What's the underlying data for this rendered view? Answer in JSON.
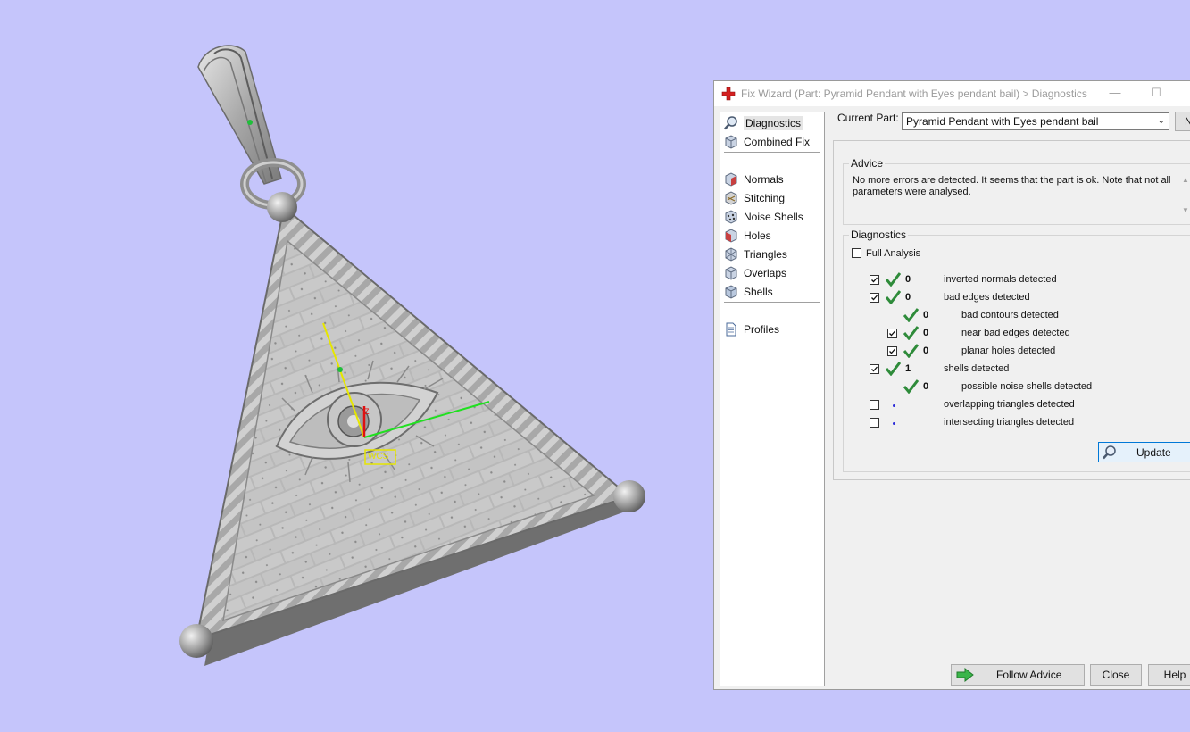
{
  "window": {
    "title": "Fix Wizard (Part: Pyramid Pendant with Eyes pendant bail) > Diagnostics",
    "minimize_symbol": "—",
    "maximize_symbol": "☐"
  },
  "viewport": {
    "axis_label_z": "Z",
    "wcs_label": "WCS",
    "background_color": "#c5c5fb"
  },
  "nav": {
    "items": [
      {
        "label": "Diagnostics",
        "icon": "magnifier-icon",
        "selected": true
      },
      {
        "label": "Combined Fix",
        "icon": "cube-icon"
      },
      {
        "label": "Normals",
        "icon": "normals-cube-icon"
      },
      {
        "label": "Stitching",
        "icon": "stitching-cube-icon"
      },
      {
        "label": "Noise Shells",
        "icon": "noise-shells-icon"
      },
      {
        "label": "Holes",
        "icon": "holes-cube-icon"
      },
      {
        "label": "Triangles",
        "icon": "triangles-cube-icon"
      },
      {
        "label": "Overlaps",
        "icon": "overlaps-cube-icon"
      },
      {
        "label": "Shells",
        "icon": "shells-cube-icon"
      },
      {
        "label": "Profiles",
        "icon": "document-icon"
      }
    ]
  },
  "current_part": {
    "label": "Current Part:",
    "value": "Pyramid Pendant with Eyes pendant bail",
    "next_button": "N"
  },
  "advice": {
    "title": "Advice",
    "text": "No more errors are detected. It seems that the part is ok. Note that not all parameters were analysed."
  },
  "diagnostics": {
    "title": "Diagnostics",
    "full_analysis_label": "Full Analysis",
    "full_analysis_checked": false,
    "rows": [
      {
        "checked": true,
        "status": "ok",
        "count": "0",
        "label": "inverted normals detected"
      },
      {
        "checked": true,
        "status": "ok",
        "count": "0",
        "label": "bad edges detected"
      },
      {
        "checked": null,
        "status": "ok",
        "count": "0",
        "label": "bad contours detected"
      },
      {
        "checked": true,
        "status": "ok",
        "count": "0",
        "label": "near bad edges detected"
      },
      {
        "checked": true,
        "status": "ok",
        "count": "0",
        "label": "planar holes detected"
      },
      {
        "checked": true,
        "status": "ok",
        "count": "1",
        "label": "shells detected"
      },
      {
        "checked": null,
        "status": "ok",
        "count": "0",
        "label": "possible noise shells detected"
      },
      {
        "checked": false,
        "status": "pending",
        "count": "",
        "label": "overlapping triangles detected"
      },
      {
        "checked": false,
        "status": "pending",
        "count": "",
        "label": "intersecting triangles detected"
      }
    ],
    "update_button": "Update"
  },
  "footer": {
    "follow_advice": "Follow Advice",
    "close": "Close",
    "help": "Help"
  },
  "colors": {
    "check_green": "#2e8b3a",
    "pending_dot": "#2b2bd8",
    "accent_blue": "#0078d7"
  }
}
